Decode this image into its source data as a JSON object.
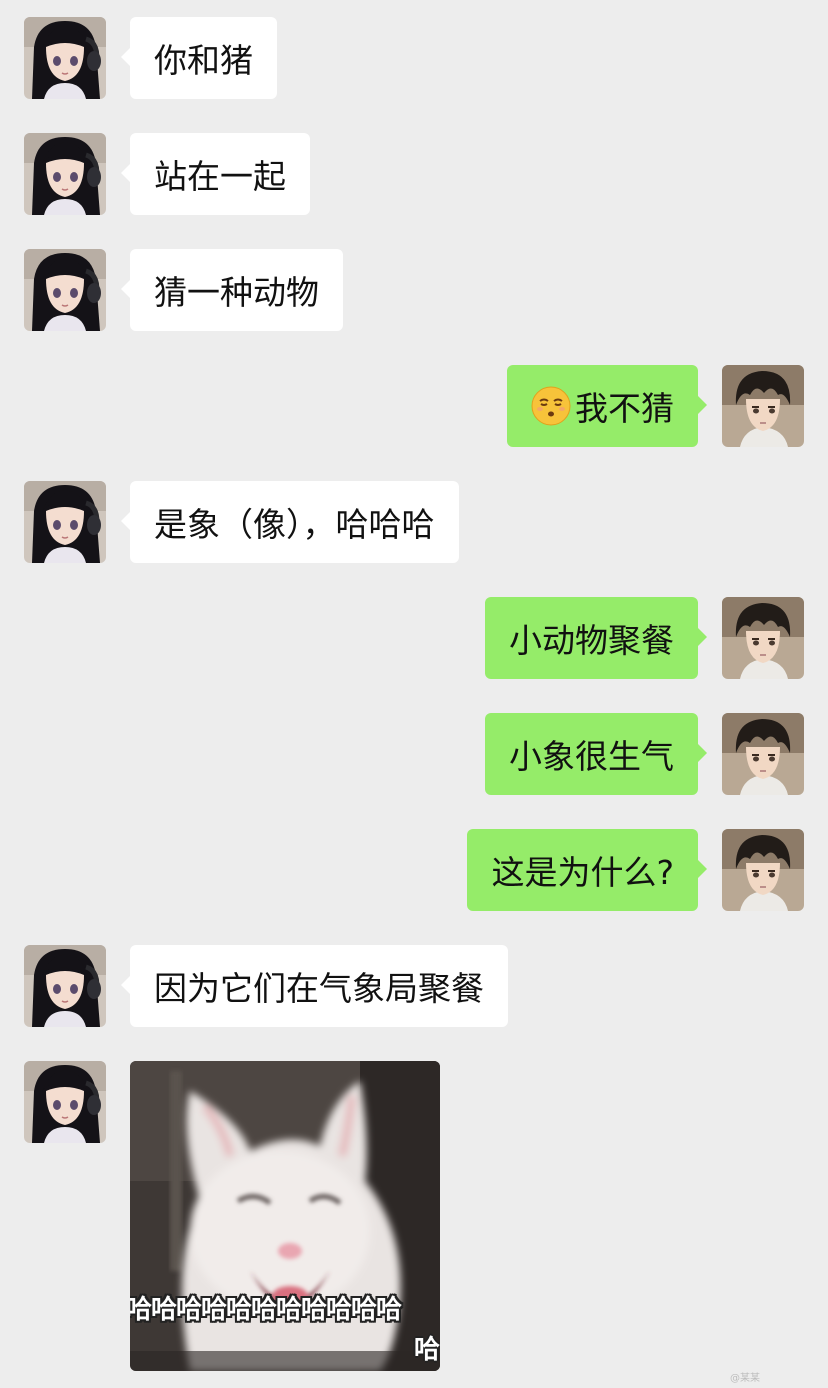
{
  "chat": {
    "messages": [
      {
        "sender": "other",
        "text": "你和猪"
      },
      {
        "sender": "other",
        "text": "站在一起"
      },
      {
        "sender": "other",
        "text": "猜一种动物"
      },
      {
        "sender": "self",
        "text": "我不猜",
        "emoji": "unamused-face-emoji"
      },
      {
        "sender": "other",
        "text": "是象（像），哈哈哈"
      },
      {
        "sender": "self",
        "text": "小动物聚餐"
      },
      {
        "sender": "self",
        "text": "小象很生气"
      },
      {
        "sender": "self",
        "text": "这是为什么?"
      },
      {
        "sender": "other",
        "text": "因为它们在气象局聚餐"
      },
      {
        "sender": "other",
        "type": "sticker",
        "sticker": "laughing-cat-sticker",
        "caption": "哈哈哈哈哈哈哈哈哈哈哈",
        "caption2": "哈"
      }
    ]
  },
  "colors": {
    "background": "#ededed",
    "incoming_bubble": "#ffffff",
    "outgoing_bubble": "#95ec69"
  },
  "watermark": "@某某"
}
